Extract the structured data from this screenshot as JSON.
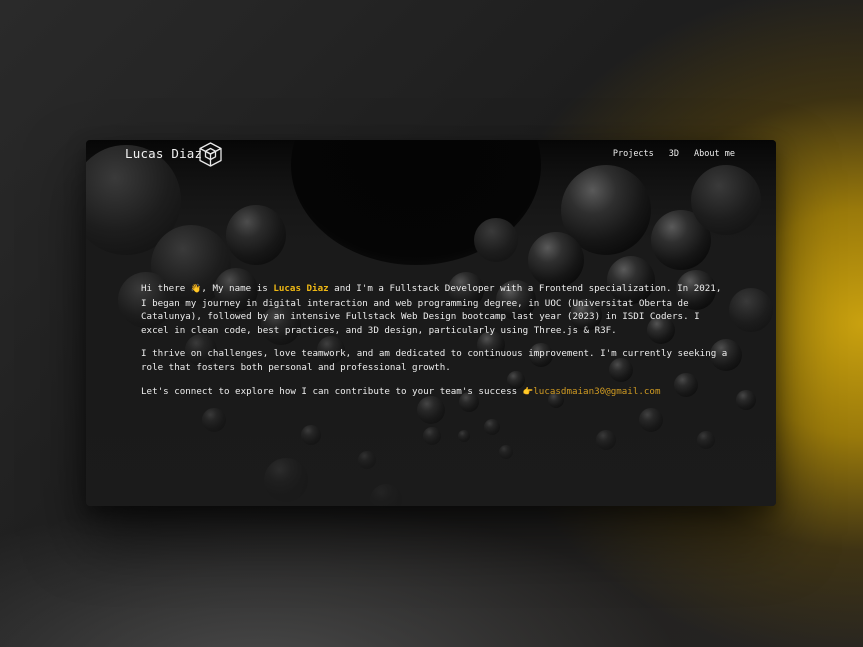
{
  "nav": {
    "brand": "Lucas Diaz",
    "links": [
      "Projects",
      "3D",
      "About me"
    ]
  },
  "about": {
    "p1_before_name": "Hi there ",
    "wave_emoji": "👋",
    "p1_after_wave": ", My name is ",
    "name": "Lucas Diaz",
    "p1_rest": " and I'm a Fullstack Developer with a Frontend specialization. In 2021, I began my journey in digital interaction and web programming degree, in UOC (Universitat Oberta de Catalunya), followed by an intensive Fullstack Web Design bootcamp last year (2023) in ISDI Coders. I excel in clean code, best practices, and 3D design, particularly using Three.js & R3F.",
    "p2": "I thrive on challenges, love teamwork, and am dedicated to continuous improvement. I'm currently seeking a role that fosters both personal and professional growth.",
    "p3_text": "Let's connect to explore how I can contribute to your team's success ",
    "pointing_emoji": "👉",
    "email": "lucasdmaian30@gmail.com"
  },
  "colors": {
    "accent": "#f0b914",
    "link": "#cf9a22",
    "background_glow": "#c9a10f",
    "window_bg": "#1b1b1b"
  },
  "icons": {
    "logo": "cube-icon"
  }
}
